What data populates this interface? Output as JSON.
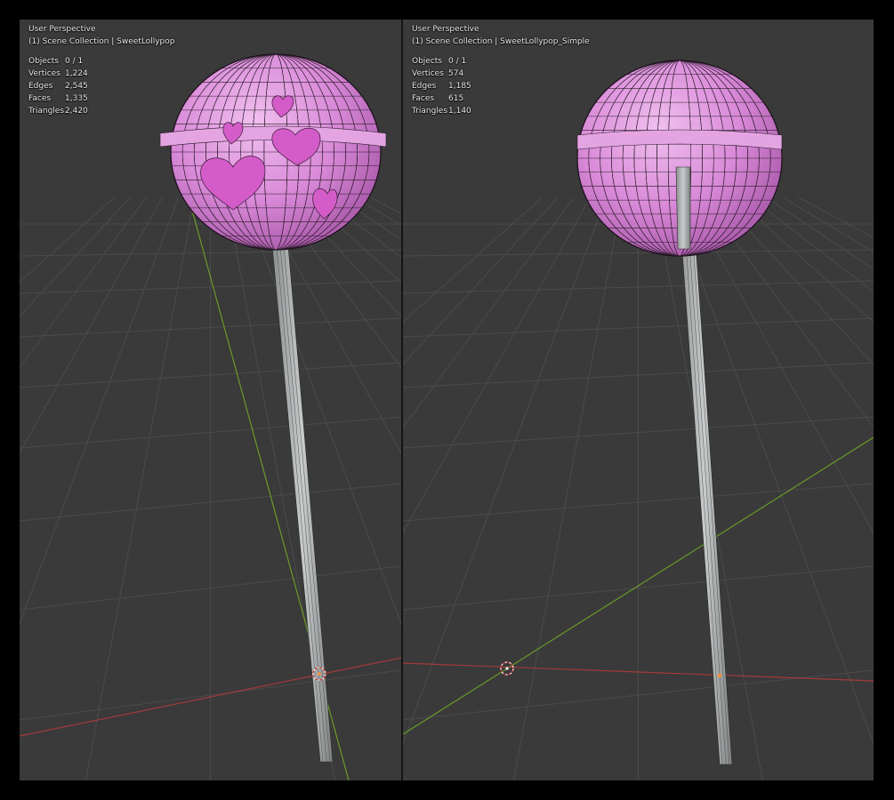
{
  "viewports": [
    {
      "title": "User Perspective",
      "collection": "(1) Scene Collection | SweetLollypop",
      "stats": [
        {
          "label": "Objects",
          "value": "0 / 1"
        },
        {
          "label": "Vertices",
          "value": "1,224"
        },
        {
          "label": "Edges",
          "value": "2,545"
        },
        {
          "label": "Faces",
          "value": "1,335"
        },
        {
          "label": "Triangles",
          "value": "2,420"
        }
      ]
    },
    {
      "title": "User Perspective",
      "collection": "(1) Scene Collection | SweetLollypop_Simple",
      "stats": [
        {
          "label": "Objects",
          "value": "0 / 1"
        },
        {
          "label": "Vertices",
          "value": "574"
        },
        {
          "label": "Edges",
          "value": "1,185"
        },
        {
          "label": "Faces",
          "value": "615"
        },
        {
          "label": "Triangles",
          "value": "1,140"
        }
      ]
    }
  ],
  "colors": {
    "background": "#3a3a3a",
    "grid": "#4a4a4a",
    "x_axis": "#a33a3a",
    "y_axis": "#6a9a2a",
    "candy": "#d98ad8",
    "wire": "#2a1a2a",
    "stick": "#b4b8b8",
    "origin": "#ff8c3a"
  }
}
